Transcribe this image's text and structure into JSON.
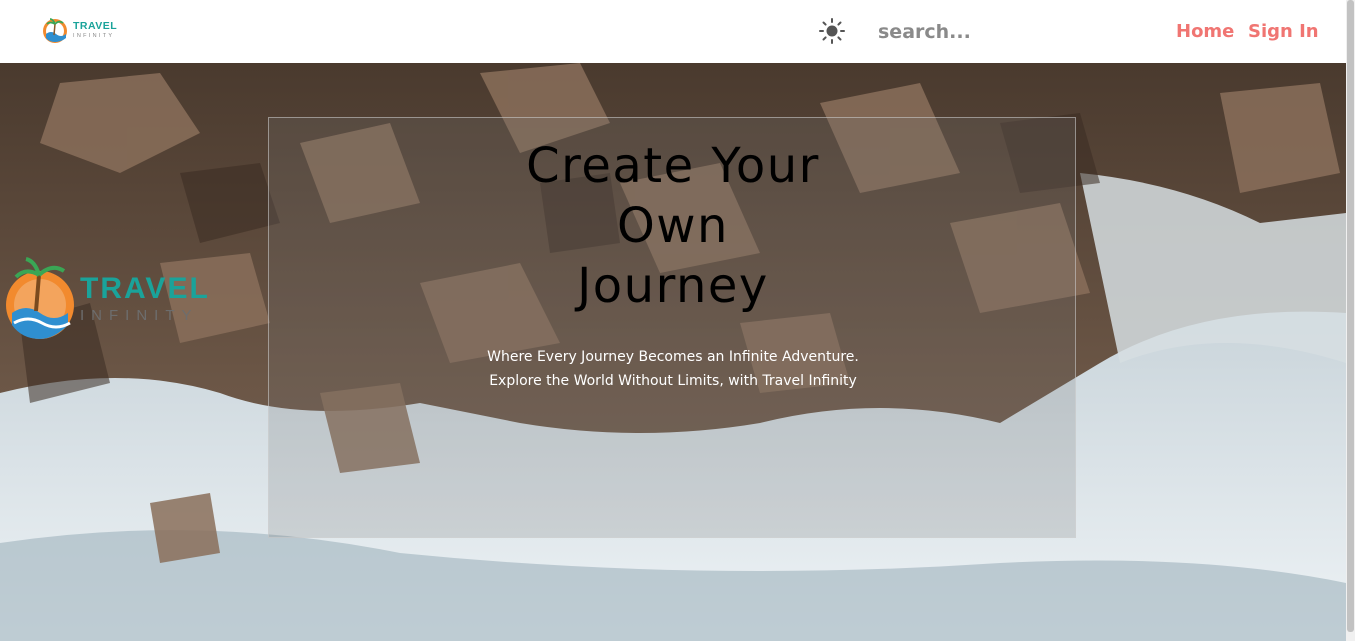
{
  "nav": {
    "logo": {
      "word1": "TRAVEL",
      "word2": "INFINITY"
    },
    "theme_icon": "sun-icon",
    "search_placeholder": "search...",
    "links": {
      "home": "Home",
      "sign_in": "Sign In"
    }
  },
  "hero": {
    "logo": {
      "word1": "TRAVEL",
      "word2": "INFINITY"
    },
    "title_lines": [
      "Create Your",
      "Own",
      "Journey"
    ],
    "subtitle_lines": [
      "Where Every Journey Becomes an Infinite Adventure.",
      "Explore the World Without Limits, with Travel Infinity"
    ]
  },
  "colors": {
    "accent": "#f07572",
    "brand_teal": "#1aa39a",
    "logo_orange": "#f28a2e",
    "logo_blue": "#2f8fd0"
  }
}
